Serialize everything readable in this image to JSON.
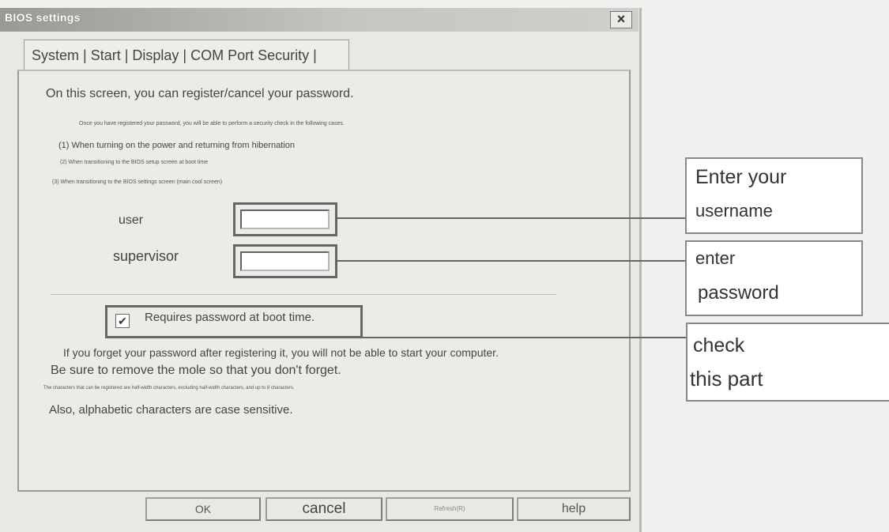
{
  "window": {
    "title": "BIOS settings",
    "close_glyph": "×",
    "close_icon": "close-icon"
  },
  "tabs": {
    "label": "System | Start | Display | COM Port Security |"
  },
  "content": {
    "intro": "On this screen, you can register/cancel your password.",
    "info": "Once you have registered your password, you will be able to perform a security check in the following cases.",
    "case1": "(1) When turning on the power and returning from hibernation",
    "case2": "(2) When transitioning to the BIOS setup screen at boot time",
    "case3": "(3) When transitioning to the BIOS settings screen (main cool screen)",
    "user_label": "user",
    "supervisor_label": "supervisor",
    "user_value": "",
    "supervisor_value": "",
    "checkbox_label": "Requires password at boot time.",
    "checkbox_checked": true,
    "checkbox_glyph": "✔",
    "forget_note": "If you forget your password after registering it, you will not be able to start your computer.",
    "remove_note": "Be sure to remove the mole so that you don't forget.",
    "chars_note": "The characters that can be registered are half-width characters, excluding half-width characters, and up to 8 characters.",
    "case_note": "Also, alphabetic characters are case sensitive."
  },
  "buttons": {
    "ok": "OK",
    "cancel": "cancel",
    "refresh": "Refresh(R)",
    "help": "help"
  },
  "callouts": {
    "username": {
      "line1": "Enter your",
      "line2": "username"
    },
    "password": {
      "line1": "enter",
      "line2": "password"
    },
    "check": {
      "line1": "check",
      "line2": "this part"
    }
  }
}
